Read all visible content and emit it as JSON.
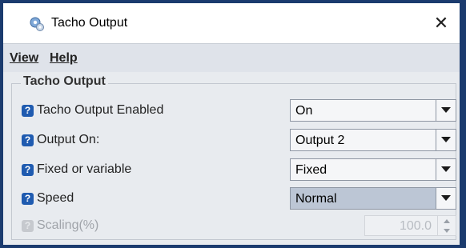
{
  "window": {
    "title": "Tacho Output",
    "close_glyph": "✕",
    "app_icon": "app-gear-icon"
  },
  "menu": {
    "items": [
      {
        "label": "View",
        "mnemonic": "V"
      },
      {
        "label": "Help",
        "mnemonic": "H"
      }
    ]
  },
  "group": {
    "title": "Tacho Output",
    "rows": [
      {
        "label": "Tacho Output Enabled",
        "control": "combo",
        "value": "On",
        "enabled": true
      },
      {
        "label": "Output On:",
        "control": "combo",
        "value": "Output 2",
        "enabled": true
      },
      {
        "label": "Fixed or variable",
        "control": "combo",
        "value": "Fixed",
        "enabled": true
      },
      {
        "label": "Speed",
        "control": "combo",
        "value": "Normal",
        "enabled": true,
        "highlighted": true
      },
      {
        "label": "Scaling(%)",
        "control": "spinner",
        "value": "100.0",
        "enabled": false
      }
    ]
  },
  "colors": {
    "window_border": "#1b3b6e",
    "help_icon": "#1f5bb0",
    "combo_highlight": "#bcc6d5"
  }
}
